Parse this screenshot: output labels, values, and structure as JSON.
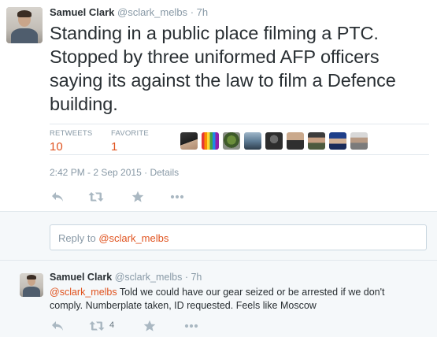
{
  "main_tweet": {
    "fullname": "Samuel Clark",
    "username": "@sclark_melbs",
    "separator": "·",
    "time": "7h",
    "text": "Standing in a public place filming a PTC. Stopped by three uniformed AFP officers saying its against the law to film a Defence building.",
    "stats": {
      "retweets_label": "RETWEETS",
      "retweets_value": "10",
      "favorites_label": "FAVORITE",
      "favorites_value": "1"
    },
    "favorited_by_icons": [
      "user-avatar-icon",
      "rainbow-flag-avatar-icon",
      "plant-avatar-icon",
      "user-avatar-icon",
      "dark-avatar-icon",
      "user-avatar-icon",
      "user-avatar-icon",
      "user-avatar-icon",
      "user-avatar-icon"
    ],
    "timestamp": "2:42 PM - 2 Sep 2015",
    "details_separator": "·",
    "details_label": "Details"
  },
  "reply_box": {
    "prefix": "Reply to ",
    "mention": "@sclark_melbs"
  },
  "reply_tweet": {
    "fullname": "Samuel Clark",
    "username": "@sclark_melbs",
    "separator": "·",
    "time": "7h",
    "mention": "@sclark_melbs",
    "text": " Told we could have our gear seized or be arrested if we don't comply. Numberplate taken, ID requested. Feels like Moscow",
    "retweet_count": "4"
  },
  "colors": {
    "accent": "#e0531f",
    "muted": "#8899a6",
    "text": "#292f33",
    "icon": "#aab8c2"
  }
}
